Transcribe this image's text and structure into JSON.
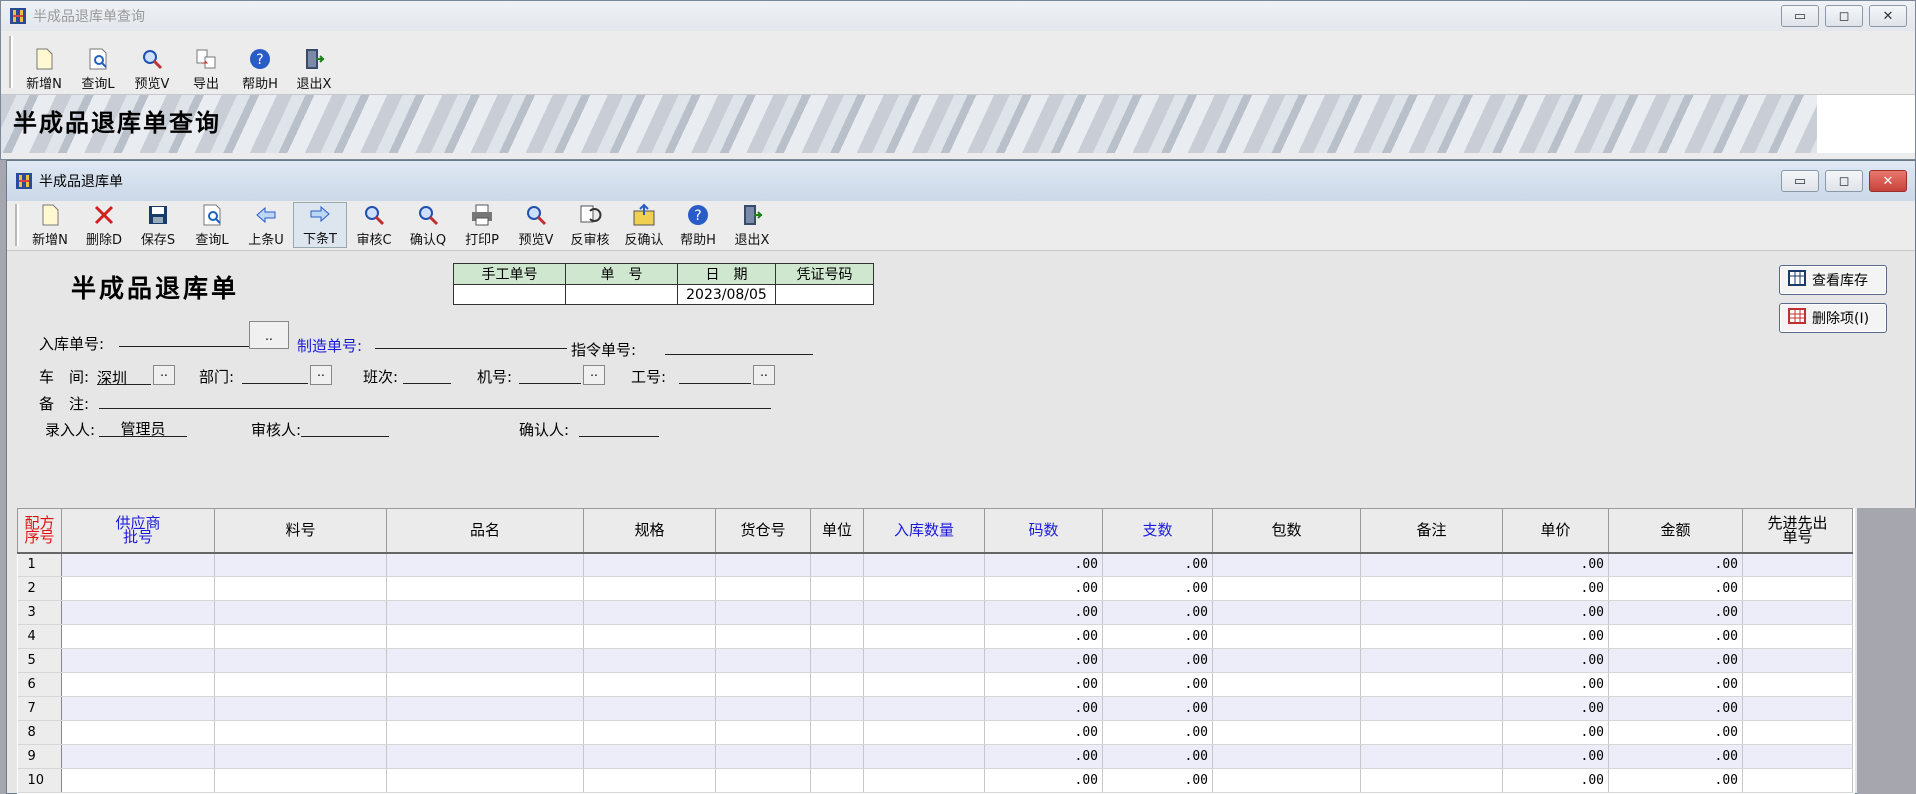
{
  "bg_window": {
    "title": "半成品退库单查询",
    "toolbar": [
      "新增N",
      "查询L",
      "预览V",
      "导出",
      "帮助H",
      "退出X"
    ],
    "banner_title": "半成品退库单查询"
  },
  "fg_window": {
    "title": "半成品退库单",
    "toolbar": [
      "新增N",
      "删除D",
      "保存S",
      "查询L",
      "上条U",
      "下条T",
      "审核C",
      "确认Q",
      "打印P",
      "预览V",
      "反审核",
      "反确认",
      "帮助H",
      "退出X"
    ]
  },
  "form": {
    "heading": "半成品退库单",
    "info_table": {
      "headers": [
        "手工单号",
        "单　号",
        "日　期",
        "凭证号码"
      ],
      "values": [
        "",
        "",
        "2023/08/05",
        ""
      ]
    },
    "labels": {
      "ruku_no": "入库单号:",
      "zhizao_no": "制造单号:",
      "zhiling_no": "指令单号:",
      "chejian": "车　间:",
      "bumen": "部门:",
      "banci": "班次:",
      "jihao": "机号:",
      "gonghao": "工号:",
      "beizhu": "备　注:",
      "luru": "录入人:",
      "shenhe": "审核人:",
      "queren": "确认人:"
    },
    "values": {
      "chejian": "深圳",
      "luru": "管理员"
    },
    "dd_label": "..",
    "buttons": {
      "check_stock": "查看库存",
      "delete_item": "删除项(I)"
    }
  },
  "grid": {
    "columns": [
      {
        "l1": "配方",
        "l2": "序号",
        "cls": "red"
      },
      {
        "l1": "供应商",
        "l2": "批号",
        "cls": "blue"
      },
      {
        "l1": "料号",
        "l2": "",
        "cls": ""
      },
      {
        "l1": "品名",
        "l2": "",
        "cls": ""
      },
      {
        "l1": "规格",
        "l2": "",
        "cls": ""
      },
      {
        "l1": "货仓号",
        "l2": "",
        "cls": ""
      },
      {
        "l1": "单位",
        "l2": "",
        "cls": ""
      },
      {
        "l1": "入库数量",
        "l2": "",
        "cls": "blue"
      },
      {
        "l1": "码数",
        "l2": "",
        "cls": "blue"
      },
      {
        "l1": "支数",
        "l2": "",
        "cls": "blue"
      },
      {
        "l1": "包数",
        "l2": "",
        "cls": ""
      },
      {
        "l1": "备注",
        "l2": "",
        "cls": ""
      },
      {
        "l1": "单价",
        "l2": "",
        "cls": ""
      },
      {
        "l1": "金额",
        "l2": "",
        "cls": ""
      },
      {
        "l1": "先进先出",
        "l2": "单号",
        "cls": ""
      }
    ],
    "rows": [
      {
        "no": "1",
        "mashu": ".00",
        "zhishu": ".00",
        "danjia": ".00",
        "jine": ".00"
      },
      {
        "no": "2",
        "mashu": ".00",
        "zhishu": ".00",
        "danjia": ".00",
        "jine": ".00"
      },
      {
        "no": "3",
        "mashu": ".00",
        "zhishu": ".00",
        "danjia": ".00",
        "jine": ".00"
      },
      {
        "no": "4",
        "mashu": ".00",
        "zhishu": ".00",
        "danjia": ".00",
        "jine": ".00"
      },
      {
        "no": "5",
        "mashu": ".00",
        "zhishu": ".00",
        "danjia": ".00",
        "jine": ".00"
      },
      {
        "no": "6",
        "mashu": ".00",
        "zhishu": ".00",
        "danjia": ".00",
        "jine": ".00"
      },
      {
        "no": "7",
        "mashu": ".00",
        "zhishu": ".00",
        "danjia": ".00",
        "jine": ".00"
      },
      {
        "no": "8",
        "mashu": ".00",
        "zhishu": ".00",
        "danjia": ".00",
        "jine": ".00"
      },
      {
        "no": "9",
        "mashu": ".00",
        "zhishu": ".00",
        "danjia": ".00",
        "jine": ".00"
      },
      {
        "no": "10",
        "mashu": ".00",
        "zhishu": ".00",
        "danjia": ".00",
        "jine": ".00"
      }
    ]
  },
  "colors": {
    "accent_blue": "#1b1bdb",
    "accent_red": "#e01010",
    "header_green": "#cfe6cf"
  }
}
